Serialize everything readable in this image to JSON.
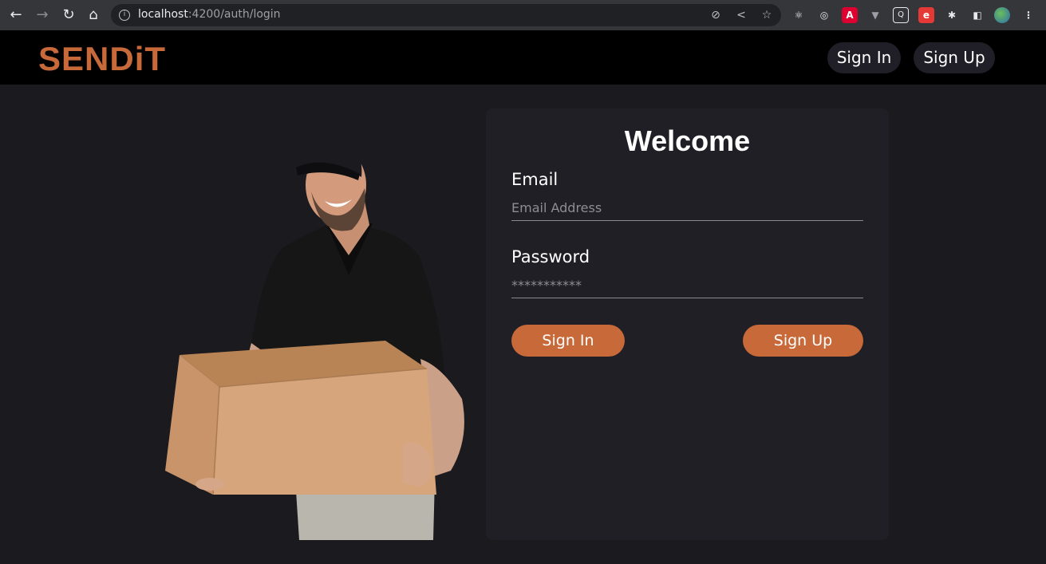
{
  "browser": {
    "url_host": "localhost",
    "url_path": ":4200/auth/login",
    "icons": [
      "back-icon",
      "forward-icon",
      "reload-icon",
      "home-icon",
      "site-info-icon",
      "eye-off-icon",
      "share-icon",
      "bookmark-star-icon",
      "react-devtools-icon",
      "extension-circle-icon",
      "angular-icon",
      "vue-icon",
      "extension-search-icon",
      "extension-e-icon",
      "puzzle-icon",
      "sidepanel-icon",
      "profile-avatar-icon",
      "menu-icon"
    ]
  },
  "header": {
    "logo": "SENDiT",
    "signin_label": "Sign In",
    "signup_label": "Sign Up"
  },
  "card": {
    "title": "Welcome",
    "email_label": "Email",
    "email_placeholder": "Email Address",
    "password_label": "Password",
    "password_placeholder": "***********",
    "signin_label": "Sign In",
    "signup_label": "Sign Up"
  },
  "colors": {
    "accent": "#c8693a",
    "background": "#1b1a1f",
    "card": "#201f26",
    "header": "#000000"
  }
}
